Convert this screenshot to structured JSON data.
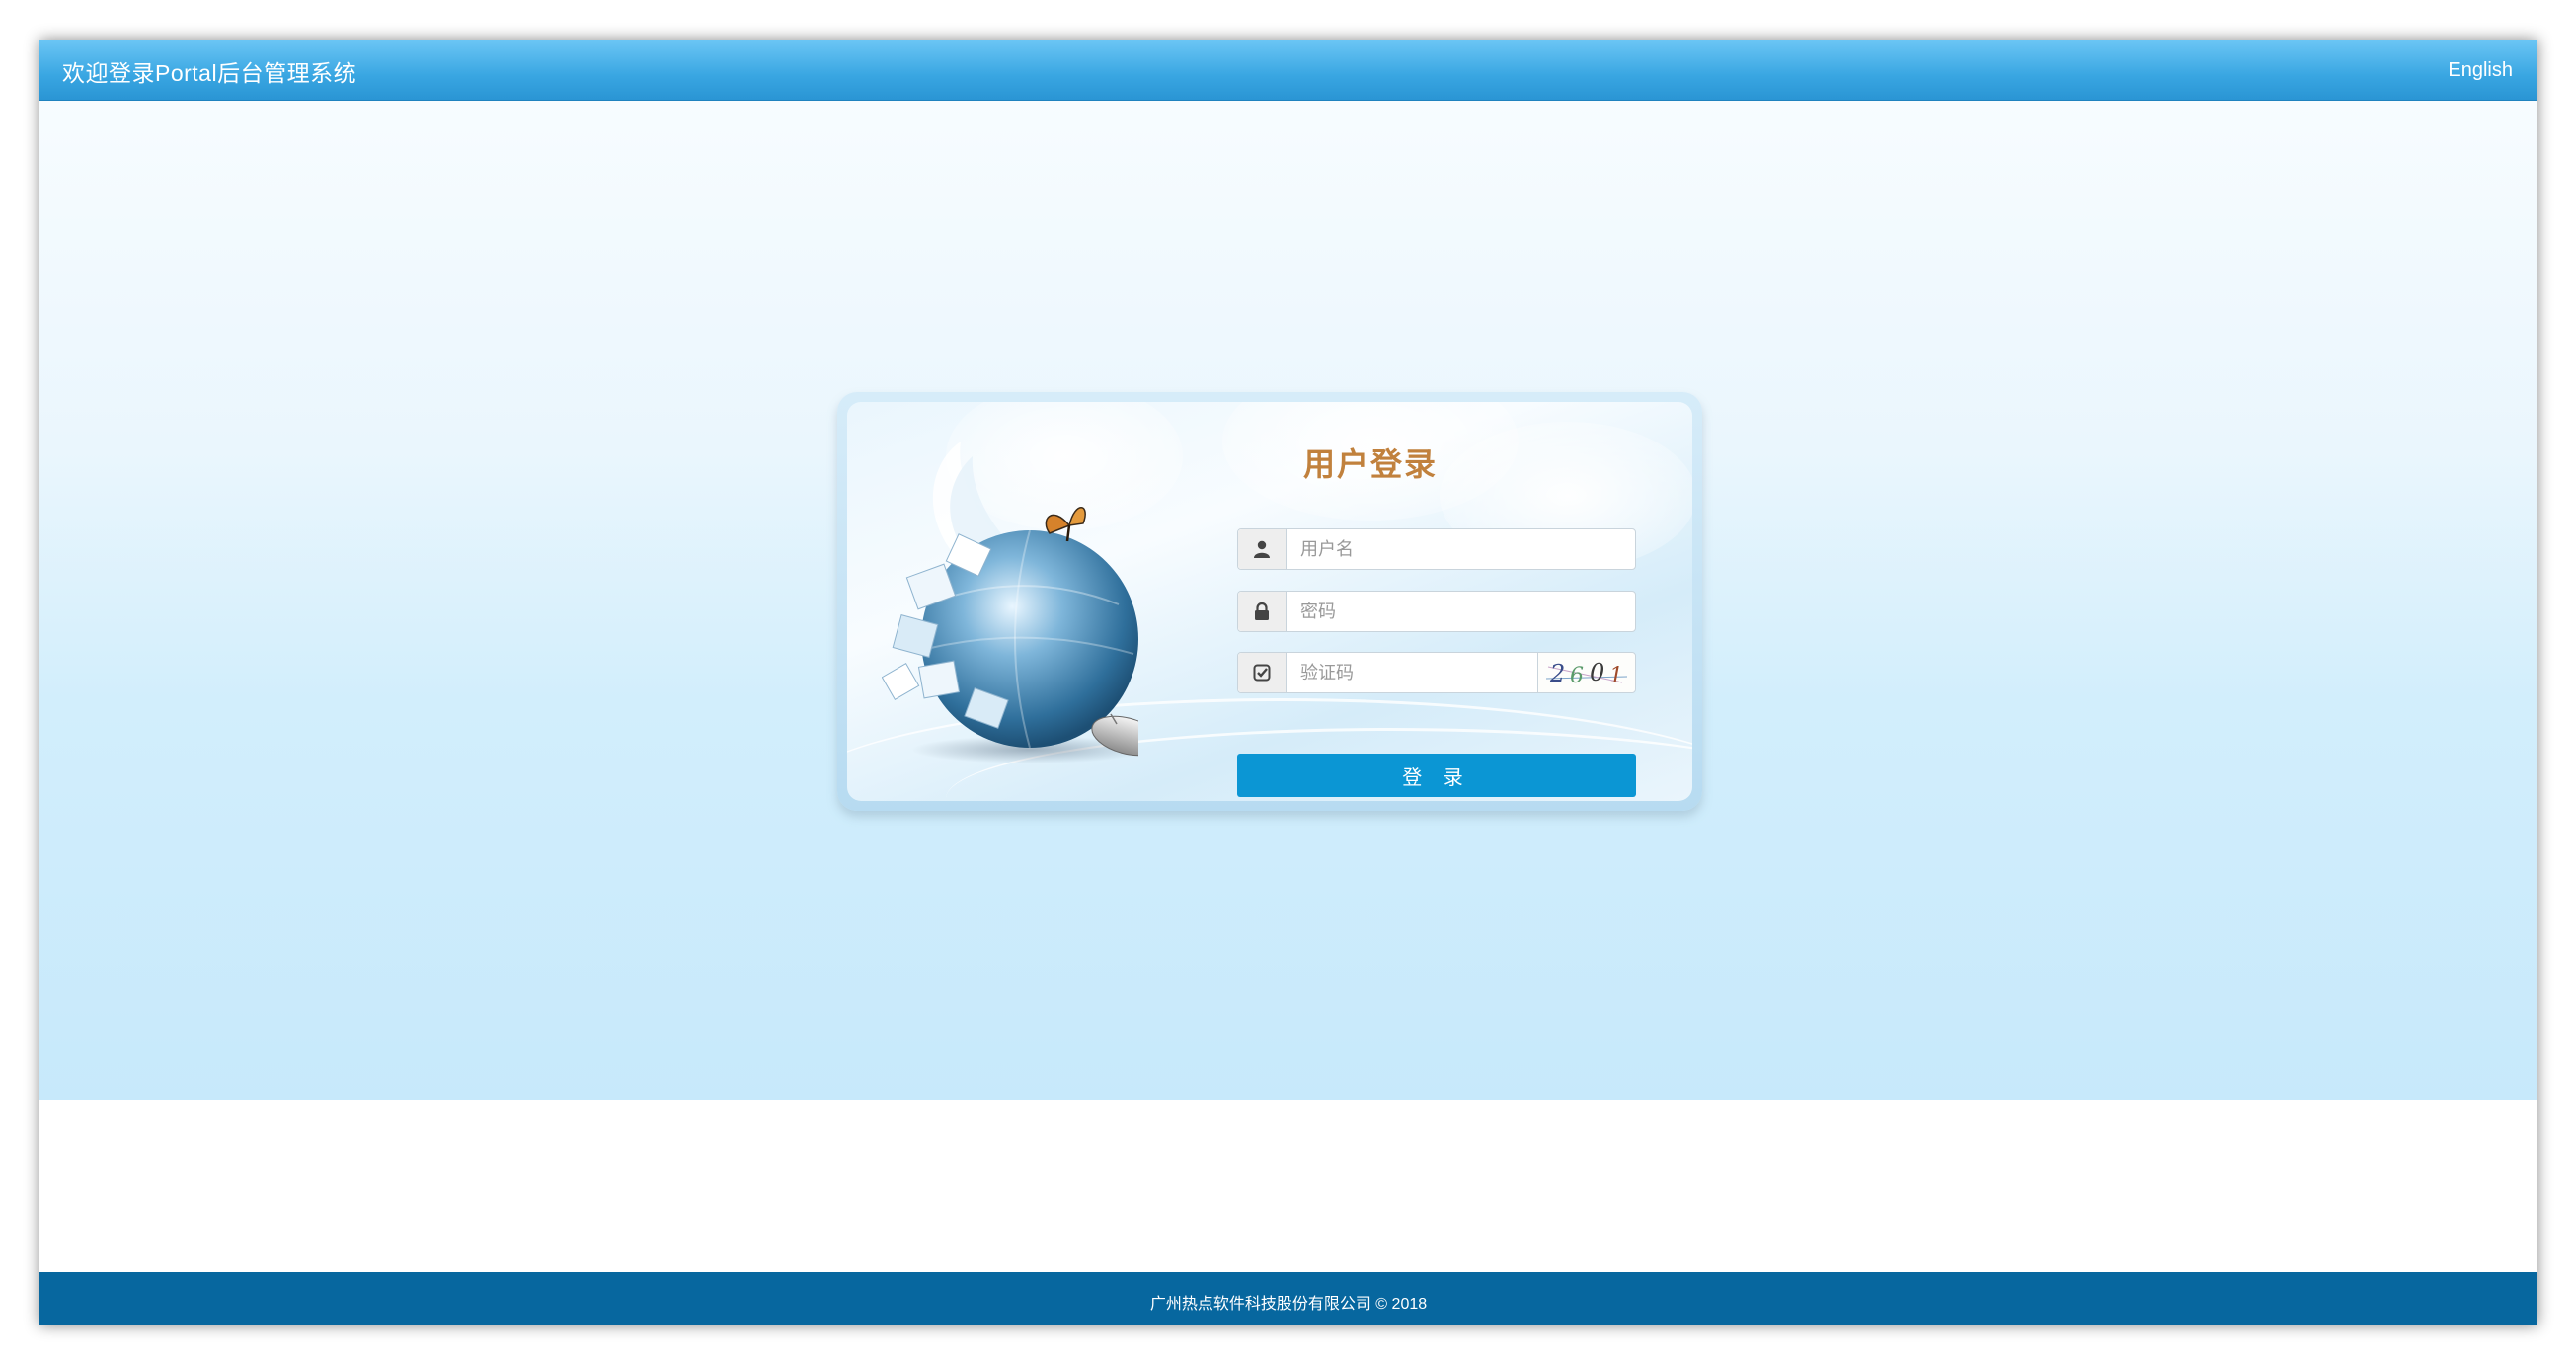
{
  "header": {
    "title": "欢迎登录Portal后台管理系统",
    "language_link": "English"
  },
  "login": {
    "title": "用户登录",
    "username": {
      "placeholder": "用户名",
      "value": "",
      "icon": "user-icon"
    },
    "password": {
      "placeholder": "密码",
      "value": "",
      "icon": "lock-icon"
    },
    "captcha": {
      "placeholder": "验证码",
      "value": "",
      "icon": "check-square-icon",
      "image_text": "2601"
    },
    "submit_label": "登 录"
  },
  "footer": {
    "copyright": "广州热点软件科技股份有限公司 © 2018"
  },
  "colors": {
    "header": "#39a6e2",
    "footer": "#07679f",
    "button": "#0b96d4",
    "login_title": "#c1813d"
  }
}
